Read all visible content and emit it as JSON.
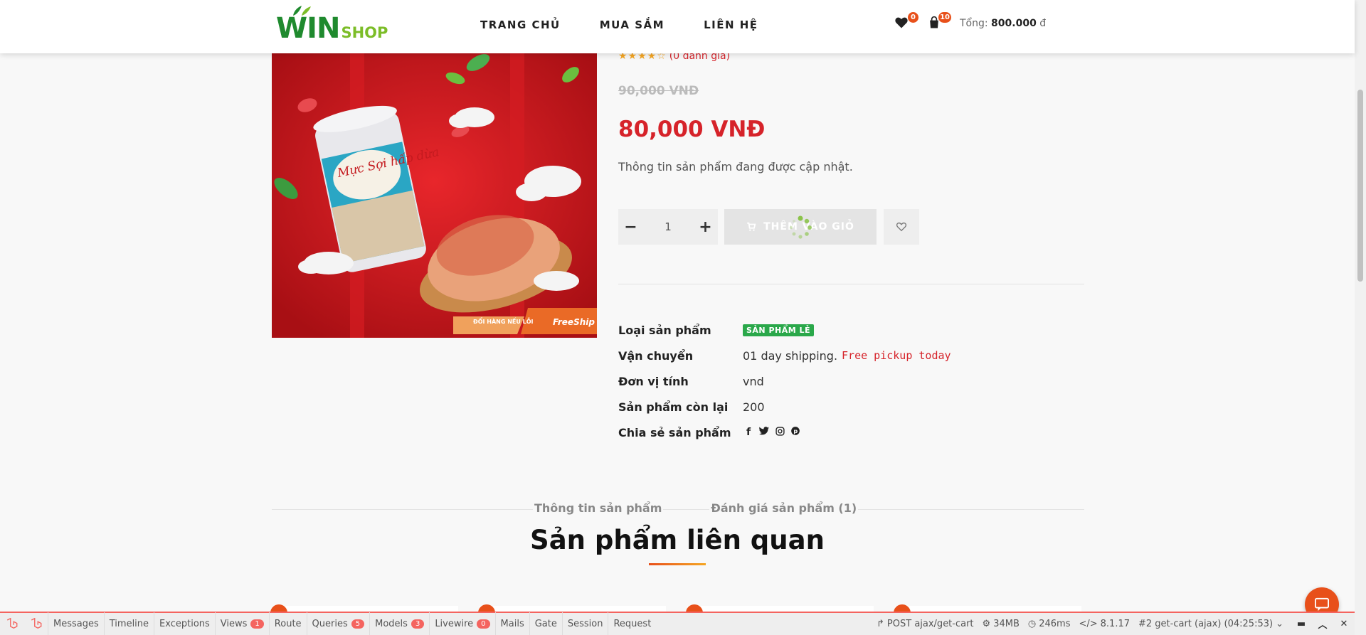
{
  "header": {
    "logo_win": "WIN",
    "logo_shop": "SHOP",
    "nav": [
      "TRANG CHỦ",
      "MUA SẮM",
      "LIÊN HỆ"
    ],
    "wishlist_count": "0",
    "cart_count": "10",
    "total_label": "Tổng:",
    "total_value": "800.000",
    "currency": "đ"
  },
  "product": {
    "stars": "★★★★☆",
    "reviews": "(0 đánh giá)",
    "old_price": "90,000 VNĐ",
    "price": "80,000 VNĐ",
    "description": "Thông tin sản phẩm đang được cập nhật.",
    "quantity": "1",
    "add_to_cart": "THÊM VÀO GIỎ",
    "image_badge_left": "ĐỔI HÀNG NẾU LỖI",
    "image_badge_right": "FreeShip",
    "image_text": "Mực Sợi hấp dừa"
  },
  "meta": {
    "type_label": "Loại sản phẩm",
    "type_value": "SẢN PHẨM LẺ",
    "shipping_label": "Vận chuyển",
    "shipping_value": "01 day shipping.",
    "shipping_free": "Free pickup today",
    "unit_label": "Đơn vị tính",
    "unit_value": "vnd",
    "stock_label": "Sản phẩm còn lại",
    "stock_value": "200",
    "share_label": "Chia sẻ sản phẩm",
    "share_icons": [
      "facebook-icon",
      "twitter-icon",
      "instagram-icon",
      "pinterest-icon"
    ]
  },
  "tabs": [
    "Thông tin sản phẩm",
    "Đánh giá sản phẩm (1)"
  ],
  "related_title": "Sản phẩm liên quan",
  "debugbar": {
    "items": [
      {
        "label": "Messages",
        "count": ""
      },
      {
        "label": "Timeline",
        "count": ""
      },
      {
        "label": "Exceptions",
        "count": ""
      },
      {
        "label": "Views",
        "count": "1"
      },
      {
        "label": "Route",
        "count": ""
      },
      {
        "label": "Queries",
        "count": "5"
      },
      {
        "label": "Models",
        "count": "3"
      },
      {
        "label": "Livewire",
        "count": "0"
      },
      {
        "label": "Mails",
        "count": ""
      },
      {
        "label": "Gate",
        "count": ""
      },
      {
        "label": "Session",
        "count": ""
      },
      {
        "label": "Request",
        "count": ""
      }
    ],
    "request": "POST ajax/get-cart",
    "memory": "34MB",
    "time": "246ms",
    "php": "8.1.17",
    "request_select": "#2 get-cart (ajax) (04:25:53)"
  },
  "colors": {
    "accent": "#d6232a",
    "orange": "#e8501a",
    "green": "#2aa84a",
    "debug_red": "#f4645f"
  }
}
